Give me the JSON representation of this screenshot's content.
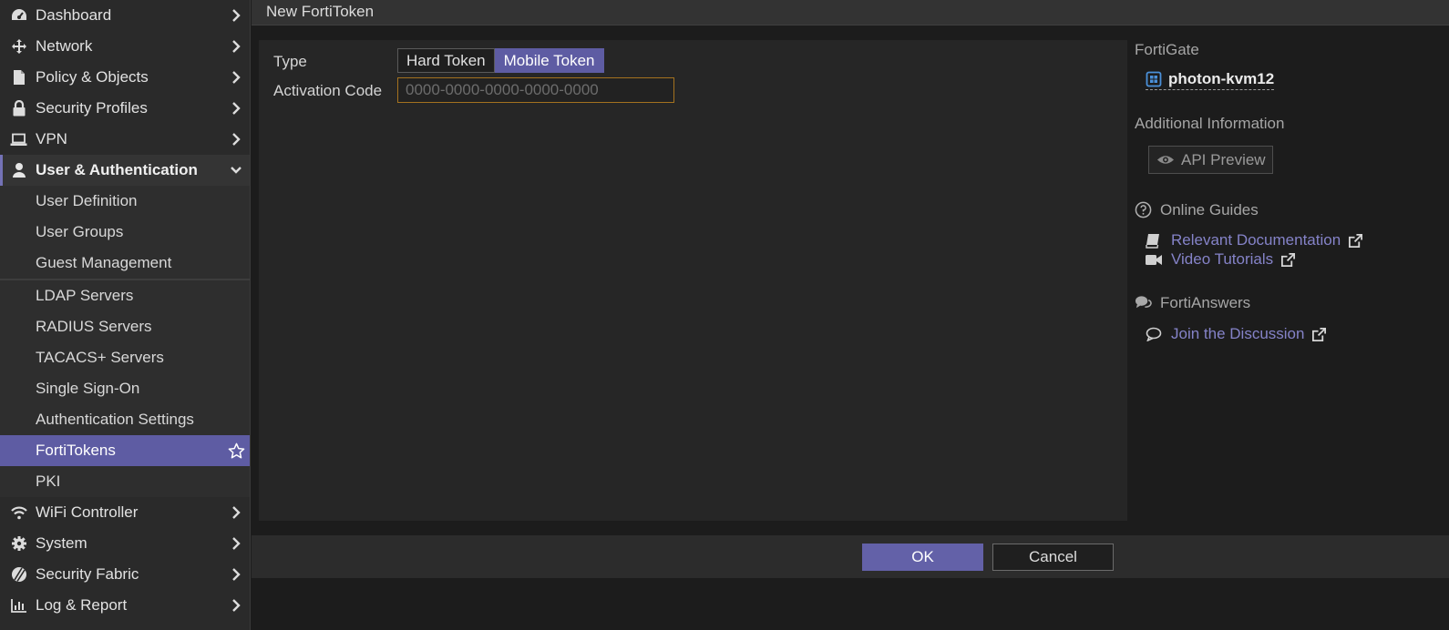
{
  "header": {
    "title": "New FortiToken"
  },
  "sidebar": {
    "items": [
      {
        "label": "Dashboard",
        "icon": "dashboard-icon"
      },
      {
        "label": "Network",
        "icon": "network-icon"
      },
      {
        "label": "Policy & Objects",
        "icon": "policy-objects-icon"
      },
      {
        "label": "Security Profiles",
        "icon": "lock-icon"
      },
      {
        "label": "VPN",
        "icon": "laptop-icon"
      },
      {
        "label": "User & Authentication",
        "icon": "user-icon",
        "expanded": true
      }
    ],
    "sub_items": [
      "User Definition",
      "User Groups",
      "Guest Management",
      "LDAP Servers",
      "RADIUS Servers",
      "TACACS+ Servers",
      "Single Sign-On",
      "Authentication Settings",
      "FortiTokens",
      "PKI"
    ],
    "selected_sub_item": "FortiTokens",
    "bottom_items": [
      {
        "label": "WiFi Controller",
        "icon": "wifi-icon"
      },
      {
        "label": "System",
        "icon": "gear-icon"
      },
      {
        "label": "Security Fabric",
        "icon": "security-fabric-icon"
      },
      {
        "label": "Log & Report",
        "icon": "bar-chart-icon"
      }
    ]
  },
  "form": {
    "type_label": "Type",
    "type_options": [
      "Hard Token",
      "Mobile Token"
    ],
    "type_selected": "Mobile Token",
    "activation_label": "Activation Code",
    "activation_value": "",
    "activation_placeholder": "0000-0000-0000-0000-0000"
  },
  "footer": {
    "ok_label": "OK",
    "cancel_label": "Cancel"
  },
  "info": {
    "fortigate_heading": "FortiGate",
    "device_name": "photon-kvm12",
    "additional_heading": "Additional Information",
    "api_preview_label": "API Preview",
    "online_guides_heading": "Online Guides",
    "relevant_docs_label": "Relevant Documentation",
    "video_tutorials_label": "Video Tutorials",
    "fortianswers_heading": "FortiAnswers",
    "join_discussion_label": "Join the Discussion"
  },
  "colors": {
    "accent": "#5e5ca3",
    "link": "#8583c8",
    "input_border": "#a4721f",
    "sidebar_bg": "#2a2a2a",
    "panel_bg": "#262626"
  }
}
